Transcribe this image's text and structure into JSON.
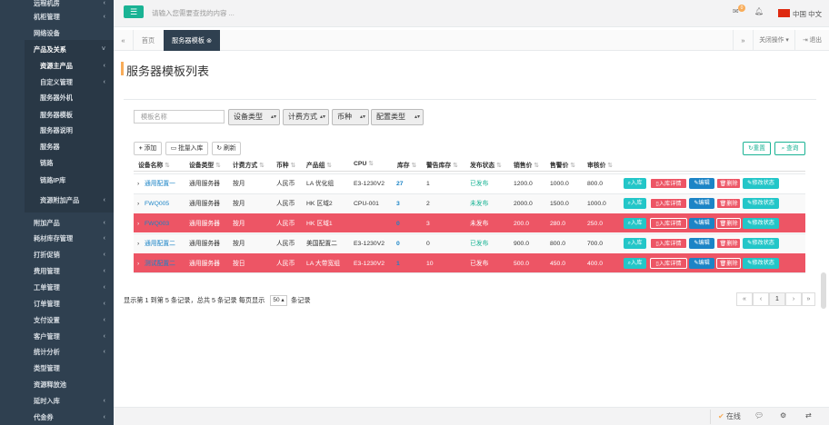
{
  "sidebar": {
    "items": [
      {
        "label": "远程机房",
        "type": "top"
      },
      {
        "label": "机柜管理",
        "type": "top"
      },
      {
        "label": "网络设备",
        "type": "top"
      },
      {
        "label": "产品及关系",
        "type": "active"
      },
      {
        "label": "资源主产品",
        "type": "sub-cur"
      },
      {
        "label": "自定义管理",
        "type": "sub"
      },
      {
        "label": "服务器外机",
        "type": "sub"
      },
      {
        "label": "服务器模板",
        "type": "sub"
      },
      {
        "label": "服务器说明",
        "type": "sub"
      },
      {
        "label": "服务器",
        "type": "sub"
      },
      {
        "label": "链路",
        "type": "sub"
      },
      {
        "label": "链路IP库",
        "type": "sub"
      },
      {
        "label": "资源附加产品",
        "type": "sub"
      },
      {
        "label": "附加产品",
        "type": "top"
      },
      {
        "label": "耗材库存管理",
        "type": "top"
      },
      {
        "label": "打折促销",
        "type": "top"
      },
      {
        "label": "费用管理",
        "type": "top"
      },
      {
        "label": "工单管理",
        "type": "top"
      },
      {
        "label": "订单管理",
        "type": "top"
      },
      {
        "label": "支付设置",
        "type": "top"
      },
      {
        "label": "客户管理",
        "type": "top"
      },
      {
        "label": "统计分析",
        "type": "top"
      },
      {
        "label": "类型管理",
        "type": "top"
      },
      {
        "label": "资源释放池",
        "type": "top"
      },
      {
        "label": "延时入库",
        "type": "top"
      },
      {
        "label": "代金券",
        "type": "top"
      }
    ]
  },
  "topbar": {
    "search_placeholder": "请输入您需要查找的内容 ...",
    "mail_badge": "0",
    "language": "中国 中文"
  },
  "tabs": {
    "home": "首页",
    "current": "服务器模板",
    "close_ops": "关闭操作",
    "logout": "退出"
  },
  "page": {
    "title": "服务器模板列表"
  },
  "filters": {
    "name_placeholder": "模板名称",
    "device_type": "设备类型",
    "billing": "计费方式",
    "currency": "币种",
    "config_type": "配置类型"
  },
  "toolbar": {
    "add": "添加",
    "batch_import": "批量入库",
    "refresh": "刷新",
    "reset": "重置",
    "search": "查询"
  },
  "table": {
    "headers": [
      "设备名称",
      "设备类型",
      "计费方式",
      "币种",
      "产品组",
      "CPU",
      "库存",
      "警告库存",
      "发布状态",
      "销售价",
      "售警价",
      "审核价"
    ],
    "rows": [
      {
        "name": "通用配置一",
        "dtype": "通用服务器",
        "billing": "按月",
        "currency": "人民币",
        "group": "LA 优化组",
        "cpu": "E3-1230V2",
        "stock": "27",
        "warn": "1",
        "status": "已发布",
        "sale": "1200.0",
        "alert": "1000.0",
        "audit": "800.0",
        "style": "normal",
        "expand": "›"
      },
      {
        "name": "FWQ005",
        "dtype": "通用服务器",
        "billing": "按月",
        "currency": "人民币",
        "group": "HK 区域2",
        "cpu": "CPU-001",
        "stock": "3",
        "warn": "2",
        "status": "未发布",
        "sale": "2000.0",
        "alert": "1500.0",
        "audit": "1000.0",
        "style": "odd",
        "expand": "›"
      },
      {
        "name": "FWQ003",
        "dtype": "通用服务器",
        "billing": "按月",
        "currency": "人民币",
        "group": "HK 区域1",
        "cpu": "",
        "stock": "0",
        "warn": "3",
        "status": "未发布",
        "sale": "200.0",
        "alert": "280.0",
        "audit": "250.0",
        "style": "err",
        "expand": "›"
      },
      {
        "name": "通用配置二",
        "dtype": "通用服务器",
        "billing": "按月",
        "currency": "人民币",
        "group": "美国配置二",
        "cpu": "E3-1230V2",
        "stock": "0",
        "warn": "0",
        "status": "已发布",
        "sale": "900.0",
        "alert": "800.0",
        "audit": "700.0",
        "style": "odd",
        "expand": "›"
      },
      {
        "name": "测试配置二",
        "dtype": "通用服务器",
        "billing": "按日",
        "currency": "人民币",
        "group": "LA 大带宽组",
        "cpu": "E3-1230V2",
        "stock": "1",
        "warn": "10",
        "status": "已发布",
        "sale": "500.0",
        "alert": "450.0",
        "audit": "400.0",
        "style": "err",
        "expand": "›"
      }
    ],
    "actions": {
      "in": "入库",
      "detail": "入库详情",
      "edit": "编辑",
      "del": "删除",
      "status": "修改状态"
    }
  },
  "pagination": {
    "info_pre": "显示第 1 到第 5 条记录，总共 5 条记录 每页显示",
    "page_size": "50",
    "info_post": "条记录",
    "first": "«",
    "prev": "‹",
    "current": "1",
    "next": "›",
    "last": "»"
  },
  "footer": {
    "online": "在线"
  },
  "colors": {
    "sidebar": "#2f4050",
    "primary": "#1ab394",
    "danger": "#ed5565",
    "info": "#23c6c8",
    "link": "#1c84c6"
  }
}
